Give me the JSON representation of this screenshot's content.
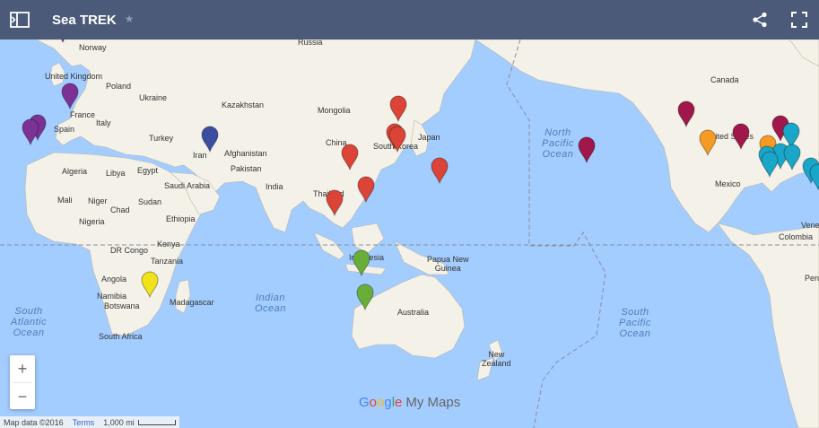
{
  "header": {
    "title": "Sea TREK",
    "star": "★"
  },
  "oceans": {
    "north_pacific": "North\nPacific\nOcean",
    "south_pacific": "South\nPacific\nOcean",
    "south_atlantic": "South\nAtlantic\nOcean",
    "indian": "Indian\nOcean"
  },
  "labels": {
    "norway": "Norway",
    "russia": "Russia",
    "uk": "United Kingdom",
    "poland": "Poland",
    "ukraine": "Ukraine",
    "france": "France",
    "italy": "Italy",
    "spain": "Spain",
    "turkey": "Turkey",
    "kazakhstan": "Kazakhstan",
    "mongolia": "Mongolia",
    "china": "China",
    "south_korea": "South Korea",
    "japan": "Japan",
    "algeria": "Algeria",
    "libya": "Libya",
    "egypt": "Egypt",
    "saudi": "Saudi Arabia",
    "afghanistan": "Afghanistan",
    "pakistan": "Pakistan",
    "iran": "Iran",
    "india": "India",
    "thailand": "Thailand",
    "mali": "Mali",
    "niger": "Niger",
    "chad": "Chad",
    "sudan": "Sudan",
    "nigeria": "Nigeria",
    "ethiopia": "Ethiopia",
    "kenya": "Kenya",
    "drc": "DR Congo",
    "tanzania": "Tanzania",
    "angola": "Angola",
    "namibia": "Namibia",
    "botswana": "Botswana",
    "madagascar": "Madagascar",
    "south_africa": "South Africa",
    "indonesia": "Indonesia",
    "png": "Papua New\nGuinea",
    "australia": "Australia",
    "new_zealand": "New\nZealand",
    "canada": "Canada",
    "us": "United States",
    "mexico": "Mexico",
    "venezuela": "Vene",
    "colombia": "Colombia",
    "peru": "Peru"
  },
  "zoom": {
    "in": "+",
    "out": "−"
  },
  "logo": {
    "google": "Google",
    "my_maps": "My Maps"
  },
  "footer": {
    "map_data": "Map data ©2016",
    "terms": "Terms",
    "scale": "1,000 mi"
  },
  "pin_colors": {
    "purple": "#7b3294",
    "crimson": "#a0174a",
    "red": "#db4437",
    "orange": "#f59a23",
    "teal": "#1aa6c8",
    "navy": "#3b4fa0",
    "green": "#6aae3a",
    "yellow": "#f2e21c"
  },
  "pins": [
    {
      "color": "purple"
    },
    {
      "color": "purple"
    },
    {
      "color": "purple"
    },
    {
      "color": "purple"
    },
    {
      "color": "navy"
    },
    {
      "color": "red"
    },
    {
      "color": "red"
    },
    {
      "color": "red"
    },
    {
      "color": "red"
    },
    {
      "color": "red"
    },
    {
      "color": "red"
    },
    {
      "color": "red"
    },
    {
      "color": "green"
    },
    {
      "color": "green"
    },
    {
      "color": "yellow"
    },
    {
      "color": "crimson"
    },
    {
      "color": "crimson"
    },
    {
      "color": "crimson"
    },
    {
      "color": "crimson"
    },
    {
      "color": "orange"
    },
    {
      "color": "orange"
    },
    {
      "color": "teal"
    },
    {
      "color": "teal"
    },
    {
      "color": "teal"
    },
    {
      "color": "teal"
    },
    {
      "color": "teal"
    },
    {
      "color": "teal"
    },
    {
      "color": "teal"
    }
  ]
}
